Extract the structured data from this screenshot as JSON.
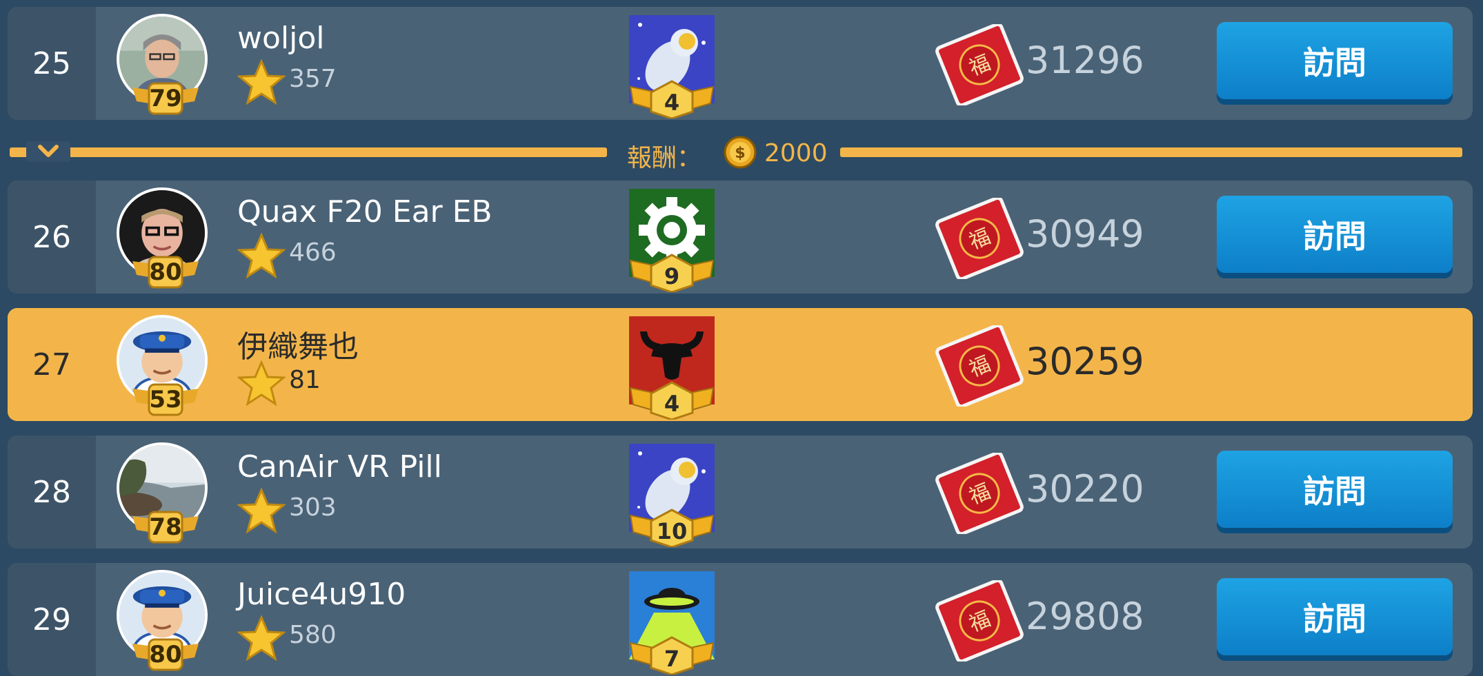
{
  "screen": {
    "reward": {
      "label": "報酬：",
      "amount": "2000"
    },
    "visit_label": "訪問",
    "rows": [
      {
        "rank": "25",
        "name": "woljol",
        "level": "79",
        "stars": "357",
        "achievement_level": "4",
        "achievement_icon": "astronaut-icon",
        "score": "31296",
        "self": false
      },
      {
        "rank": "26",
        "name": "Quax F20 Ear EB",
        "level": "80",
        "stars": "466",
        "achievement_level": "9",
        "achievement_icon": "gear-icon",
        "score": "30949",
        "self": false
      },
      {
        "rank": "27",
        "name": "伊織舞也",
        "level": "53",
        "stars": "81",
        "achievement_level": "4",
        "achievement_icon": "bull-icon",
        "score": "30259",
        "self": true
      },
      {
        "rank": "28",
        "name": "CanAir VR Pill",
        "level": "78",
        "stars": "303",
        "achievement_level": "10",
        "achievement_icon": "astronaut-icon",
        "score": "30220",
        "self": false
      },
      {
        "rank": "29",
        "name": "Juice4u910",
        "level": "80",
        "stars": "580",
        "achievement_level": "7",
        "achievement_icon": "ufo-icon",
        "score": "29808",
        "self": false
      }
    ]
  },
  "colors": {
    "background": "#2c4a63",
    "row": "#4a6276",
    "self_row": "#f3b54a",
    "button": "#1591d6",
    "accent": "#f3b54a"
  }
}
